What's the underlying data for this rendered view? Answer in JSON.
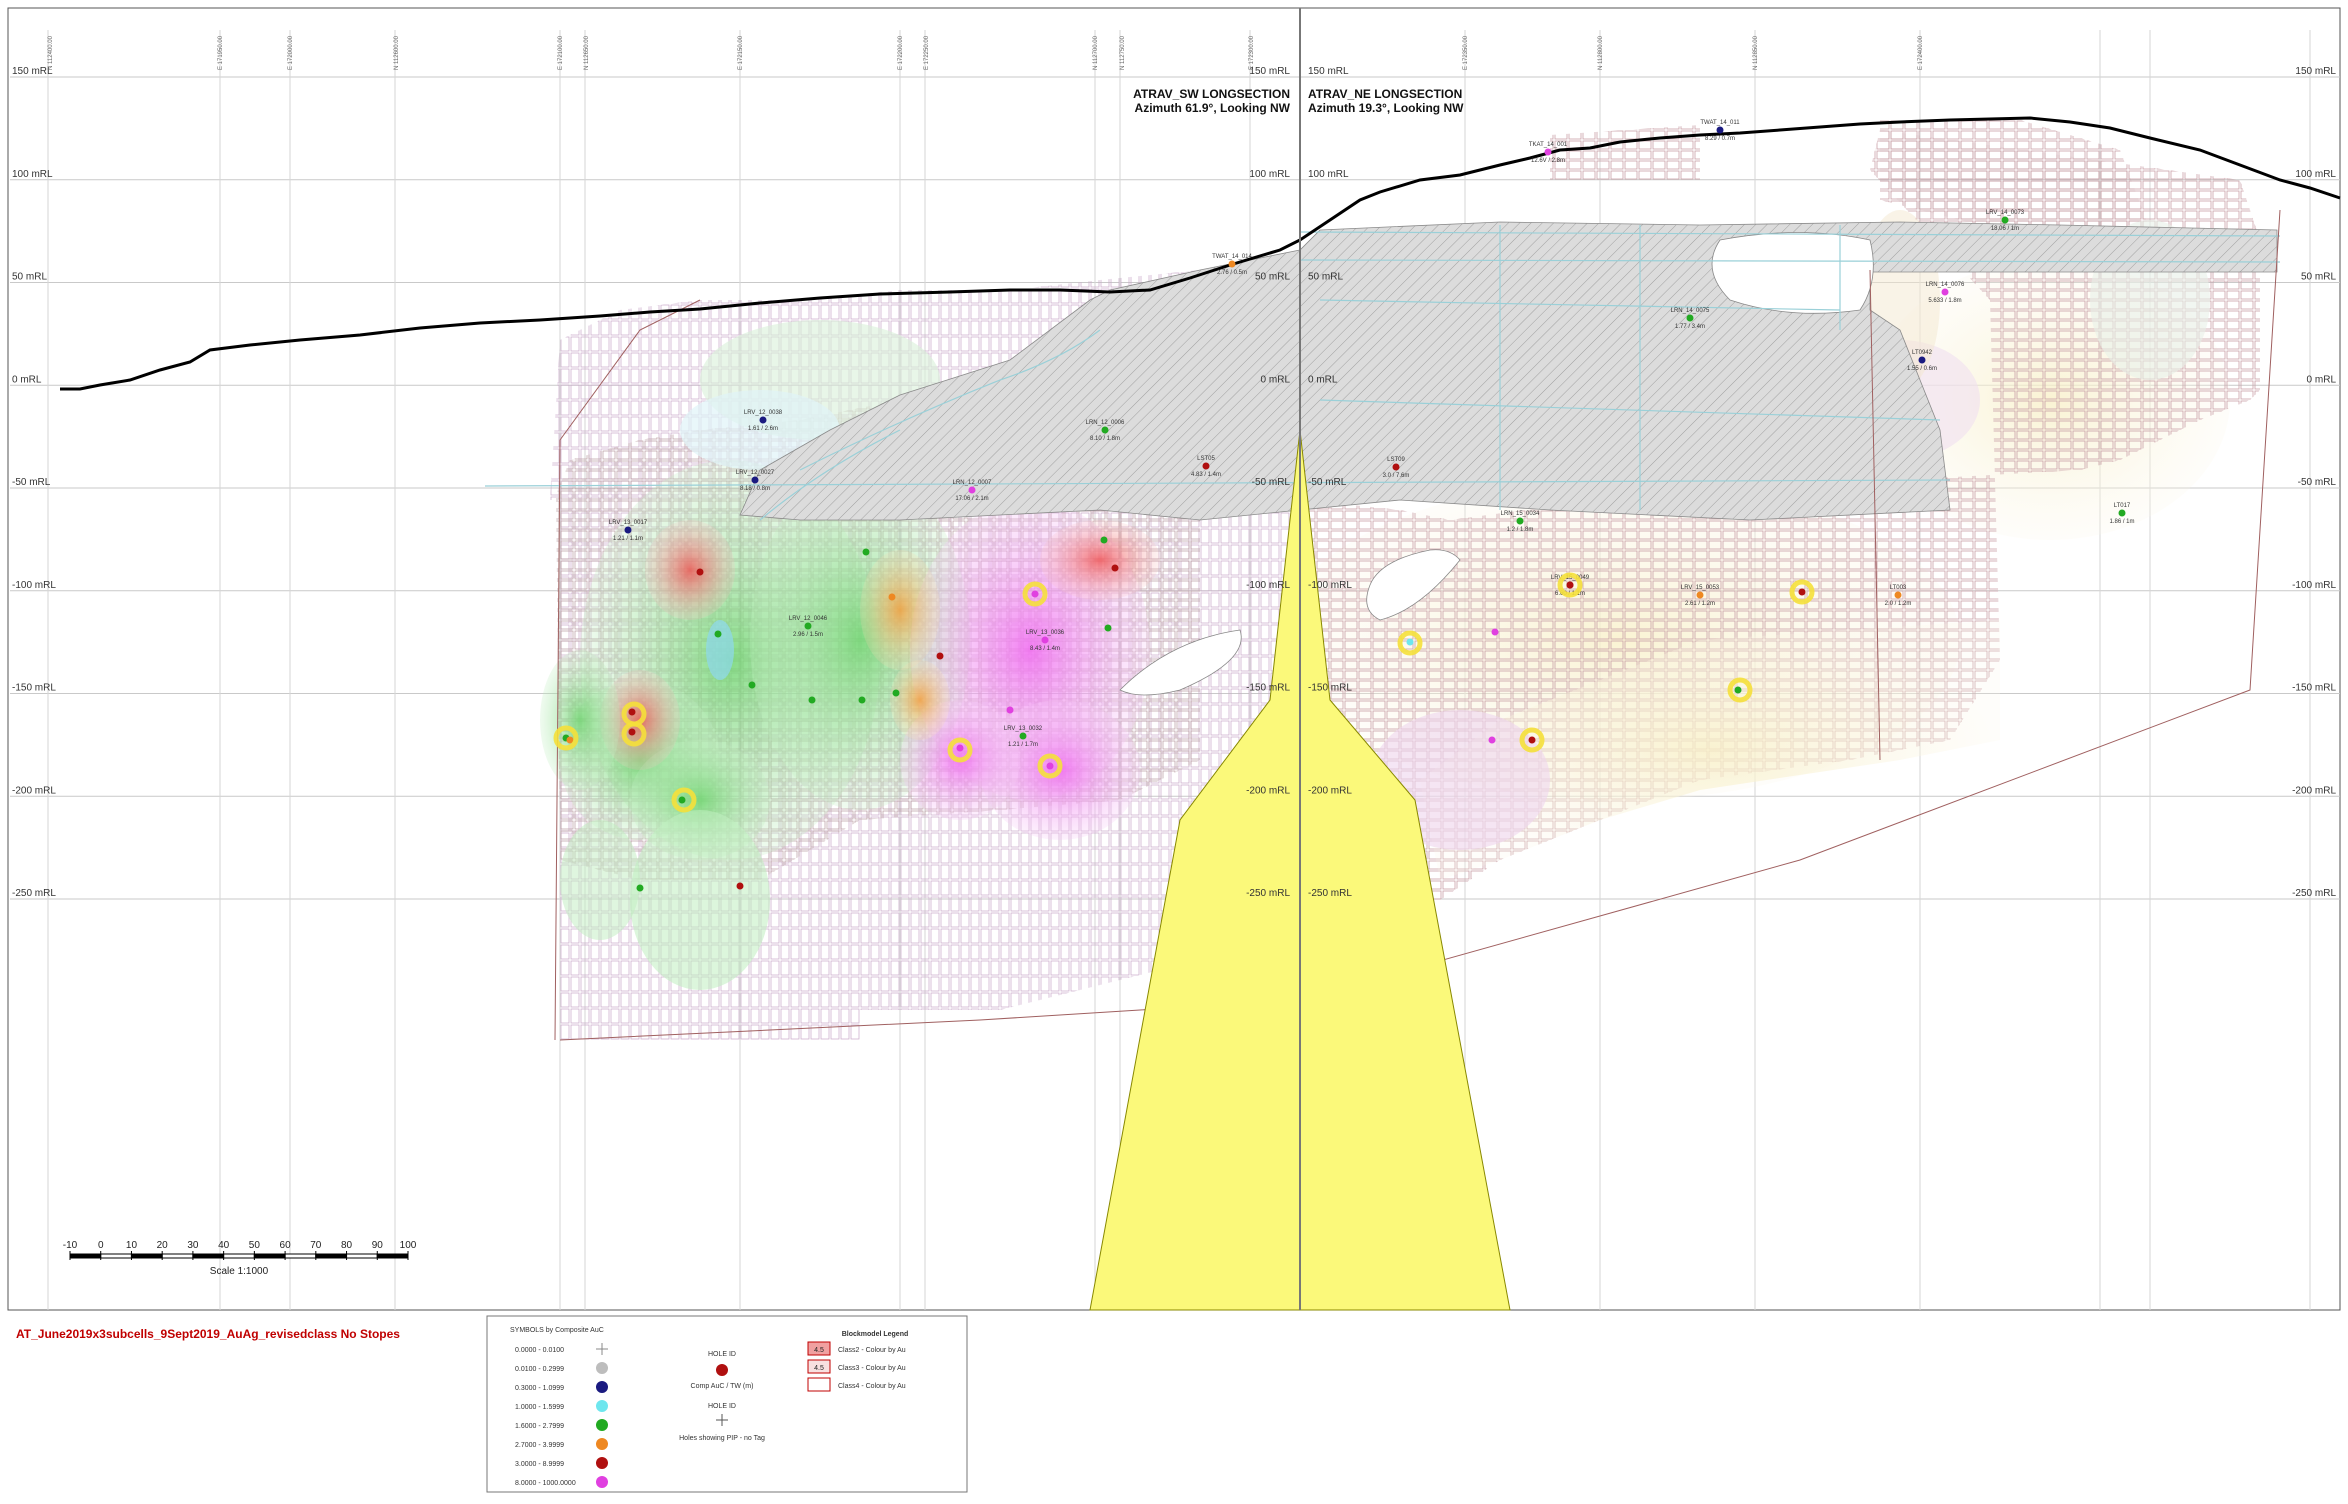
{
  "sections": [
    {
      "title": "ATRAV_SW LONGSECTION",
      "subtitle": "Azimuth 61.9°, Looking NW"
    },
    {
      "title": "ATRAV_NE LONGSECTION",
      "subtitle": "Azimuth 19.3°, Looking NW"
    }
  ],
  "rl_labels": [
    "150 mRL",
    "100 mRL",
    "50 mRL",
    "0 mRL",
    "-50 mRL",
    "-100 mRL",
    "-150 mRL",
    "-200 mRL",
    "-250 mRL"
  ],
  "easting_labels": [
    "N 112400.00",
    "E 171950.00",
    "E 172000.00",
    "N 112600.00",
    "E 172100.00",
    "N 112650.00",
    "E 172150.00",
    "E 172200.00",
    "E 172250.00",
    "N 112700.00",
    "N 112750.00",
    "E 172300.00",
    "E 172350.00",
    "N 112800.00",
    "N 112850.00",
    "E 172400.00"
  ],
  "holes": [
    {
      "id": "TWAT_14_011",
      "val": "8.29 / 0.7m",
      "c": "#1a1a80"
    },
    {
      "id": "TKAT_14_001",
      "val": "12.6V / 2.8m",
      "c": "#e040e0"
    },
    {
      "id": "LRV_14_0073",
      "val": "18.06 / 1m",
      "c": "#22aa22"
    },
    {
      "id": "TWAT_14_014",
      "val": "2.76 / 0.5m",
      "c": "#ee8822"
    },
    {
      "id": "LRN_14_0075",
      "val": "1.77 / 3.4m",
      "c": "#22aa22"
    },
    {
      "id": "LRN_14_0076",
      "val": "5.633 / 1.8m",
      "c": "#e040e0"
    },
    {
      "id": "LT0942",
      "val": "1.55 / 0.6m",
      "c": "#1a1a80"
    },
    {
      "id": "LRV_12_0038",
      "val": "1.61 / 2.6m",
      "c": "#1a1a80"
    },
    {
      "id": "LRN_12_0006",
      "val": "8.10 / 1.8m",
      "c": "#22aa22"
    },
    {
      "id": "LRN_12_0007",
      "val": "17.06 / 2.1m",
      "c": "#e040e0"
    },
    {
      "id": "LRV_12_0027",
      "val": "8.18 / 0.8m",
      "c": "#1a1a80"
    },
    {
      "id": "LST05",
      "val": "4.83 / 1.4m",
      "c": "#b01010"
    },
    {
      "id": "LST09",
      "val": "3.0 / 7.6m",
      "c": "#b01010"
    },
    {
      "id": "LRN_15_0034",
      "val": "1.2 / 1.8m",
      "c": "#22aa22"
    },
    {
      "id": "LRV_13_0017",
      "val": "1.21 / 1.1m",
      "c": "#1a1a80"
    },
    {
      "id": "LT017",
      "val": "1.86 / 1m",
      "c": "#22aa22"
    },
    {
      "id": "LRV_15_0049",
      "val": "6.60 / 1.1m",
      "c": "#b01010"
    },
    {
      "id": "LRV_15_0053",
      "val": "2.61 / 1.2m",
      "c": "#ee8822"
    },
    {
      "id": "LT003",
      "val": "2.0 / 1.2m",
      "c": "#ee8822"
    },
    {
      "id": "LRV_13_0036",
      "val": "8.43 / 1.4m",
      "c": "#e040e0"
    },
    {
      "id": "LRV_12_0046",
      "val": "2.96 / 1.5m",
      "c": "#22aa22"
    },
    {
      "id": "LRV_13_0032",
      "val": "1.21 / 1.7m",
      "c": "#22aa22"
    }
  ],
  "scale": {
    "ticks": [
      "-10",
      "0",
      "10",
      "20",
      "30",
      "40",
      "50",
      "60",
      "70",
      "80",
      "90",
      "100"
    ],
    "label": "Scale 1:1000"
  },
  "legend": {
    "symbols_title": "SYMBOLS by Composite AuC",
    "ranges": [
      {
        "text": "0.0000 - 0.0100",
        "color": "#cfcfcf",
        "symbol": "cross"
      },
      {
        "text": "0.0100 - 0.2999",
        "color": "#bdbdbd",
        "symbol": "dot"
      },
      {
        "text": "0.3000 - 1.0999",
        "color": "#1a1a80",
        "symbol": "dot"
      },
      {
        "text": "1.0000 - 1.5999",
        "color": "#6ee6ee",
        "symbol": "dot"
      },
      {
        "text": "1.6000 - 2.7999",
        "color": "#22aa22",
        "symbol": "dot"
      },
      {
        "text": "2.7000 - 3.9999",
        "color": "#ee8822",
        "symbol": "dot"
      },
      {
        "text": "3.0000 - 8.9999",
        "color": "#b01010",
        "symbol": "dot"
      },
      {
        "text": "8.0000 - 1000.0000",
        "color": "#e040e0",
        "symbol": "dot"
      }
    ],
    "hole_id_label": "HOLE ID",
    "hole_id_sub": "Comp AuC / TW (m)",
    "hole_id_label2": "HOLE ID",
    "hole_id_sub2": "Holes showing PIP - no Tag",
    "blockmodel_title": "Blockmodel Legend",
    "classes": [
      {
        "text": "Class2 - Colour by Au",
        "swatch": "#f0a0a0",
        "tag": "4.5"
      },
      {
        "text": "Class3 - Colour by Au",
        "swatch": "#f8e0e0",
        "tag": "4.5"
      },
      {
        "text": "Class4 - Colour by Au",
        "swatch": "#ffffff",
        "tag": ""
      }
    ]
  },
  "footer_text": "AT_June2019x3subcells_9Sept2019_AuAg_revisedclass No Stopes",
  "colors": {
    "cone": "#fbf97a",
    "cone_stroke": "#888800",
    "hatch": "#b8b8b8",
    "topo": "#000000",
    "grid": "#bfbfbf",
    "dot_green": "#22aa22",
    "dot_magenta": "#e040e0",
    "dot_red": "#b01010",
    "dot_orange": "#ee8822",
    "dot_navy": "#1a1a80"
  }
}
